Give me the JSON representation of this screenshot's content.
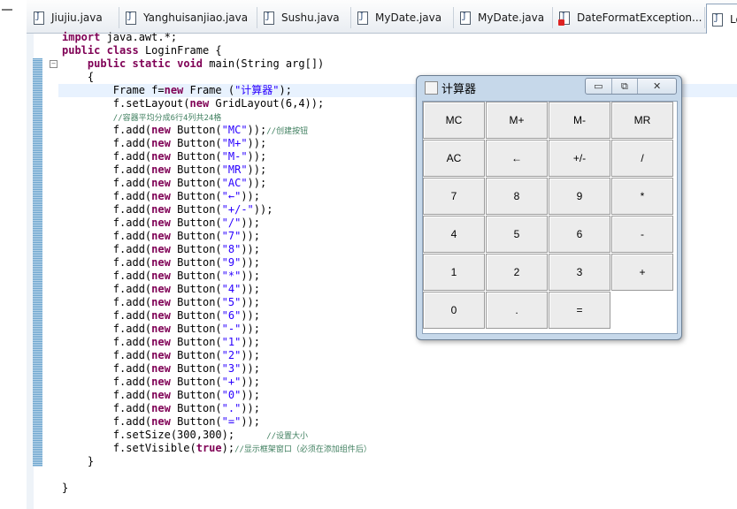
{
  "tabs": [
    {
      "label": "Jiujiu.java"
    },
    {
      "label": "Yanghuisanjiao.java"
    },
    {
      "label": "Sushu.java"
    },
    {
      "label": "MyDate.java"
    },
    {
      "label": "MyDate.java"
    },
    {
      "label": "DateFormatException..."
    },
    {
      "label": "Lo"
    }
  ],
  "code_lines": [
    "import java.awt.*;",
    "public class LoginFrame {",
    "    public static void main(String arg[])",
    "    {",
    "        Frame f=new Frame (\"计算器\");",
    "        f.setLayout(new GridLayout(6,4));",
    "        //容器平均分成6行4列共24格",
    "        f.add(new Button(\"MC\"));//创建按钮",
    "        f.add(new Button(\"M+\"));",
    "        f.add(new Button(\"M-\"));",
    "        f.add(new Button(\"MR\"));",
    "        f.add(new Button(\"AC\"));",
    "        f.add(new Button(\"←\"));",
    "        f.add(new Button(\"+/-\"));",
    "        f.add(new Button(\"/\"));",
    "        f.add(new Button(\"7\"));",
    "        f.add(new Button(\"8\"));",
    "        f.add(new Button(\"9\"));",
    "        f.add(new Button(\"*\"));",
    "        f.add(new Button(\"4\"));",
    "        f.add(new Button(\"5\"));",
    "        f.add(new Button(\"6\"));",
    "        f.add(new Button(\"-\"));",
    "        f.add(new Button(\"1\"));",
    "        f.add(new Button(\"2\"));",
    "        f.add(new Button(\"3\"));",
    "        f.add(new Button(\"+\"));",
    "        f.add(new Button(\"0\"));",
    "        f.add(new Button(\".\"));",
    "        f.add(new Button(\"=\"));",
    "        f.setSize(300,300);     //设置大小",
    "        f.setVisible(true);//显示框架窗口（必须在添加组件后）",
    "    }",
    "",
    "}"
  ],
  "window": {
    "title": "计算器",
    "controls": {
      "minimize": "▭",
      "maximize": "⧉",
      "close": "✕"
    },
    "buttons": [
      "MC",
      "M+",
      "M-",
      "MR",
      "AC",
      "←",
      "+/-",
      "/",
      "7",
      "8",
      "9",
      "*",
      "4",
      "5",
      "6",
      "-",
      "1",
      "2",
      "3",
      "+",
      "0",
      ".",
      "="
    ]
  },
  "colors": {
    "keyword": "#7f0055",
    "string": "#2a00ff",
    "comment": "#3f7f5f",
    "current_line": "#e8f2fe",
    "window_frame": "#c6d8ea"
  }
}
